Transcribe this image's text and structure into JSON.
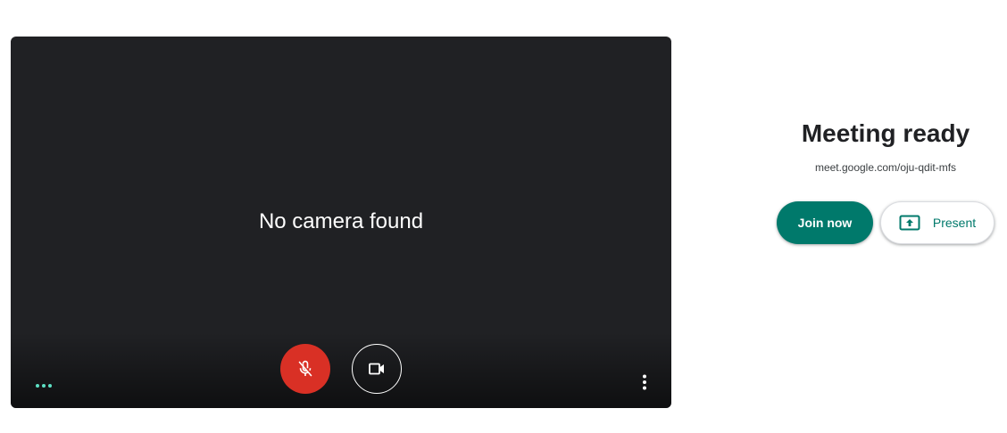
{
  "preview": {
    "status_text": "No camera found",
    "mic_state": "muted",
    "camera_state": "off",
    "colors": {
      "background": "#202124",
      "mic_button": "#d93025",
      "audio_indicator": "#5ee0c4"
    },
    "icons": {
      "mic": "mic-off-icon",
      "camera": "videocam-icon",
      "more": "more-vert-icon",
      "audio": "audio-level-dots-icon"
    }
  },
  "meeting": {
    "title": "Meeting ready",
    "link": "meet.google.com/oju-qdit-mfs"
  },
  "actions": {
    "join_label": "Join now",
    "present_label": "Present",
    "present_icon": "present-to-all-icon",
    "accent_color": "#00796b"
  }
}
